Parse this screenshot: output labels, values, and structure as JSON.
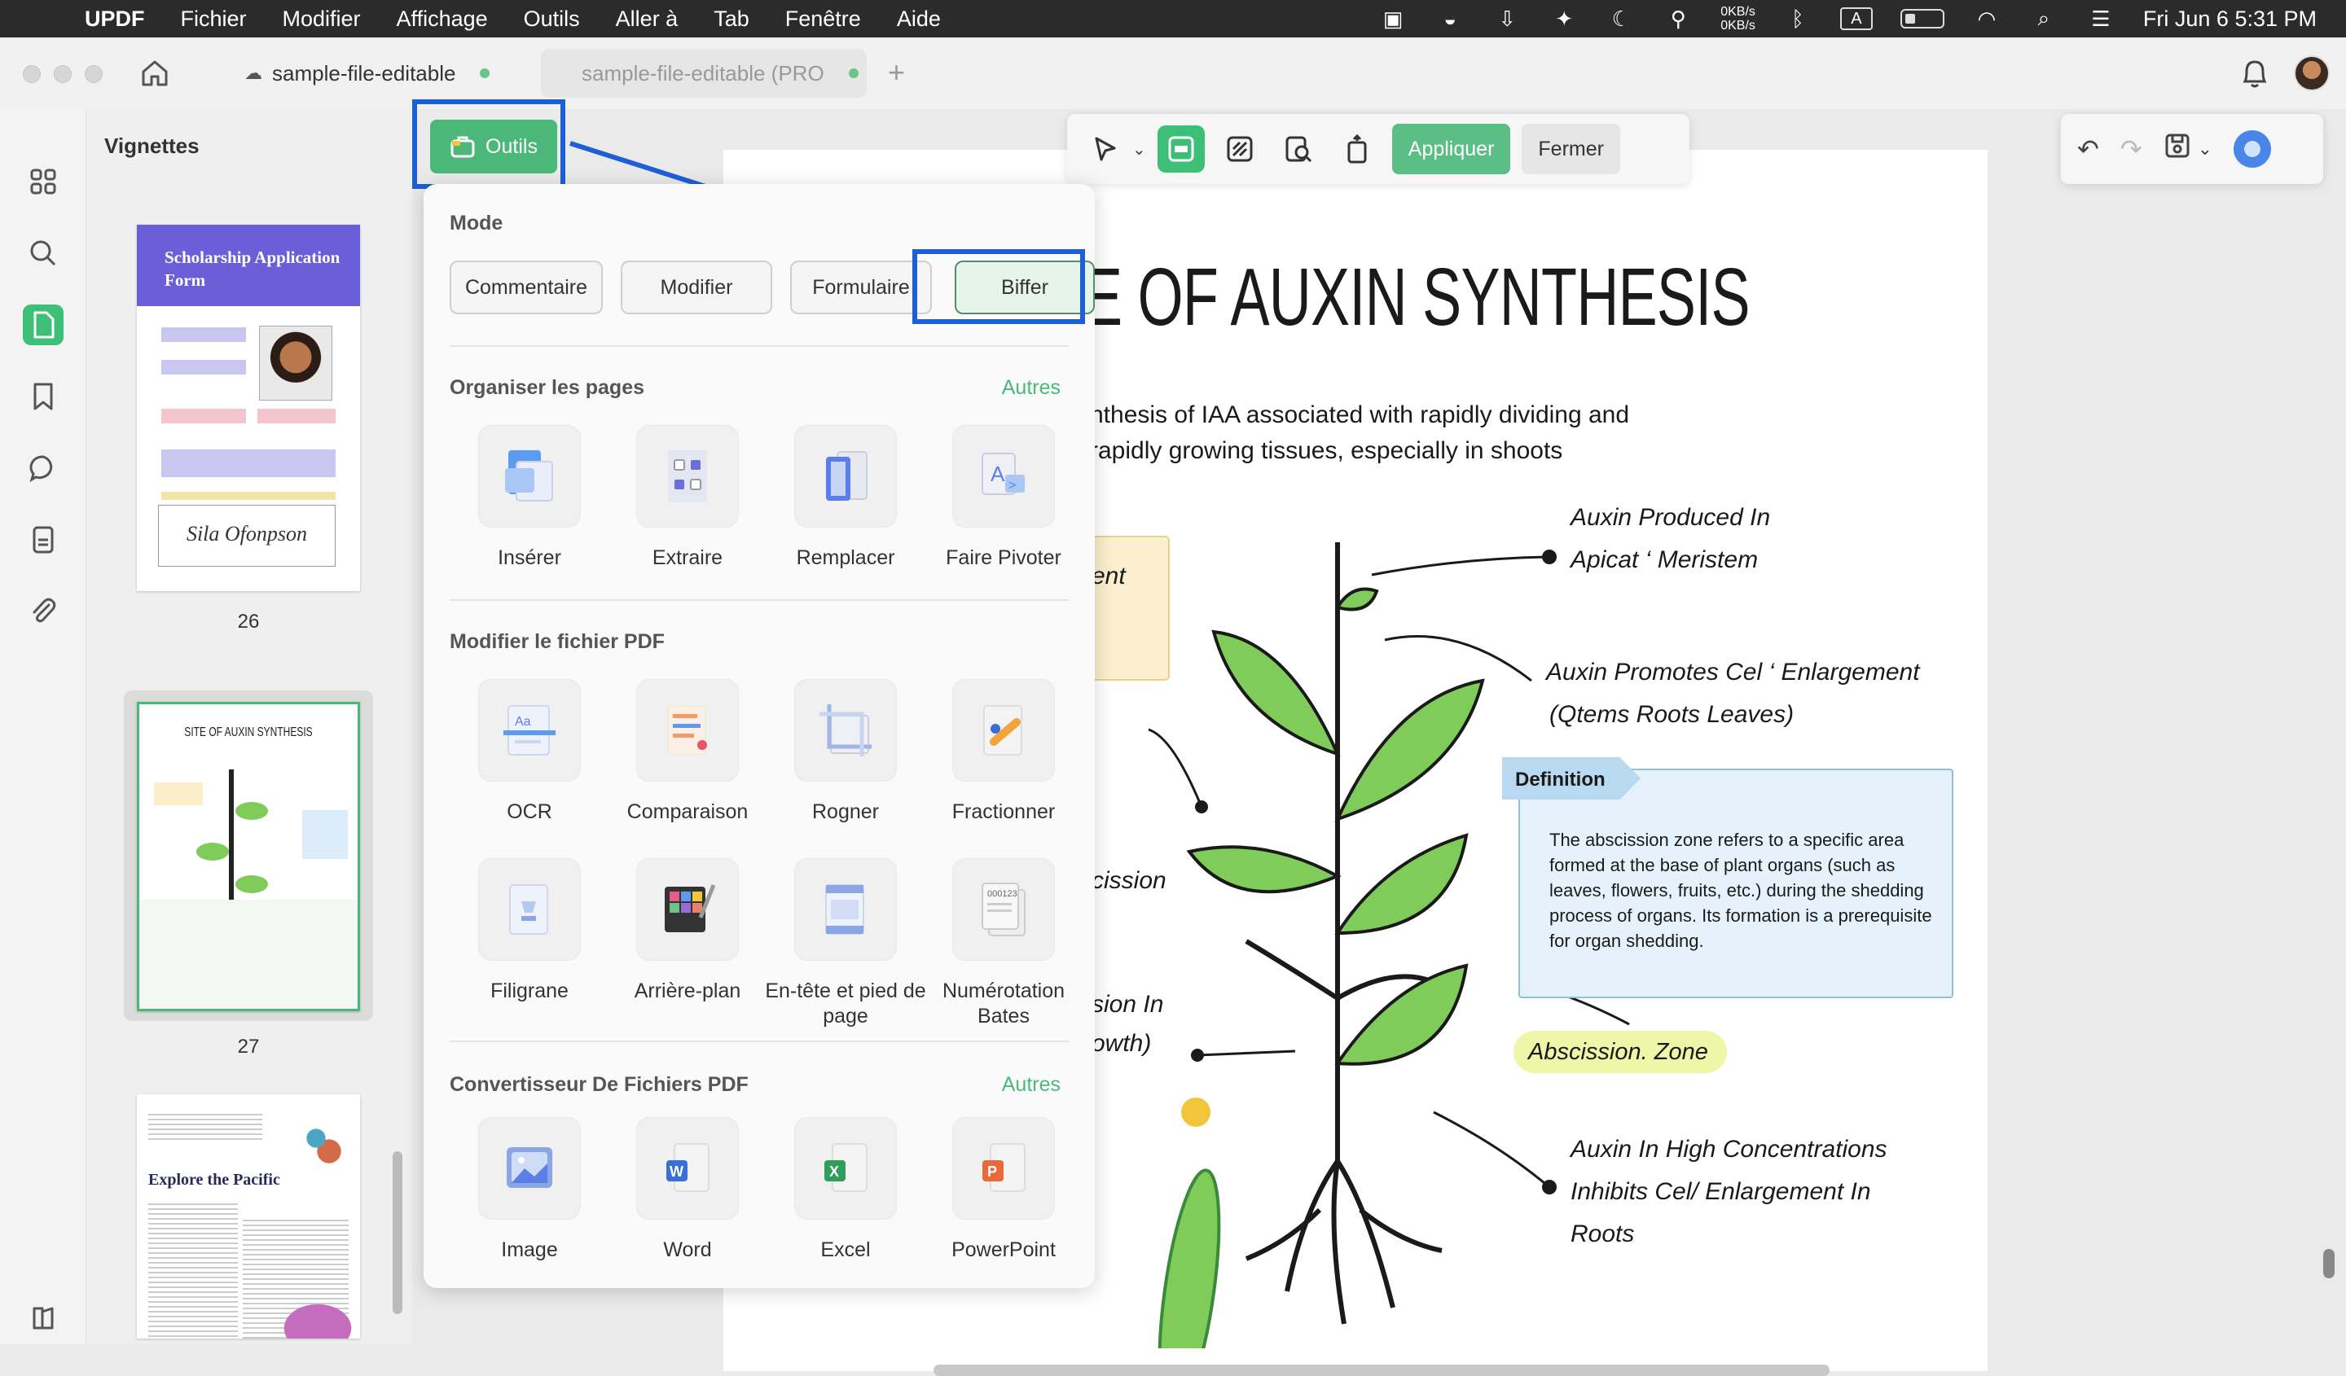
{
  "menubar": {
    "app": "UPDF",
    "items": [
      "Fichier",
      "Modifier",
      "Affichage",
      "Outils",
      "Aller à",
      "Tab",
      "Fenêtre",
      "Aide"
    ],
    "net_up": "0KB/s",
    "net_down": "0KB/s",
    "datetime": "Fri Jun 6  5:31 PM"
  },
  "tabs": {
    "active": "sample-file-editable",
    "inactive": "sample-file-editable (PRO"
  },
  "sidebar": {
    "panel_title": "Vignettes",
    "thumbs": [
      {
        "title": "Scholarship Application Form",
        "page": "26",
        "signature": "Sila Ofonpson"
      },
      {
        "title": "SITE OF AUXIN SYNTHESIS",
        "page": "27"
      },
      {
        "title": "Explore the Pacific"
      }
    ]
  },
  "toolbar": {
    "outils_label": "Outils",
    "apply_label": "Appliquer",
    "close_label": "Fermer"
  },
  "dropdown": {
    "mode_title": "Mode",
    "modes": [
      "Commentaire",
      "Modifier",
      "Formulaire",
      "Biffer"
    ],
    "organize_title": "Organiser les pages",
    "organize_more": "Autres",
    "organize_tools": [
      "Insérer",
      "Extraire",
      "Remplacer",
      "Faire Pivoter"
    ],
    "modify_title": "Modifier le fichier PDF",
    "modify_tools": [
      "OCR",
      "Comparaison",
      "Rogner",
      "Fractionner",
      "Filigrane",
      "Arrière-plan",
      "En-tête et pied de page",
      "Numérotation Bates"
    ],
    "convert_title": "Convertisseur De Fichiers PDF",
    "convert_more": "Autres",
    "convert_tools": [
      "Image",
      "Word",
      "Excel",
      "PowerPoint"
    ]
  },
  "document": {
    "title": "E OF AUXIN SYNTHESIS",
    "intro_1": "nthesis of IAA associated with rapidly dividing and",
    "intro_2": "rapidly growing tissues, especially in shoots",
    "label_produced_1": "Auxin Produced In",
    "label_produced_2": "Apicat ‘ Meristem",
    "label_promotes_1": "Auxin Promotes Cel ‘ Enlargement",
    "label_promotes_2": "(Qtems Roots Leaves)",
    "def_title": "Definition",
    "def_text": "The abscission zone refers to a specific area formed at the base of plant organs (such as leaves, flowers, fruits, etc.) during the shedding process of organs. Its formation is a prerequisite for organ shedding.",
    "zone_label": "Abscission. Zone",
    "label_high_1": "Auxin In High Concentrations",
    "label_high_2": "Inhibits Cel/ Enlargement In",
    "label_high_3": "Roots",
    "frag_ent": "ent",
    "frag_cission": "cission",
    "frag_sion_in": "sion In",
    "frag_owth": "owth)"
  }
}
